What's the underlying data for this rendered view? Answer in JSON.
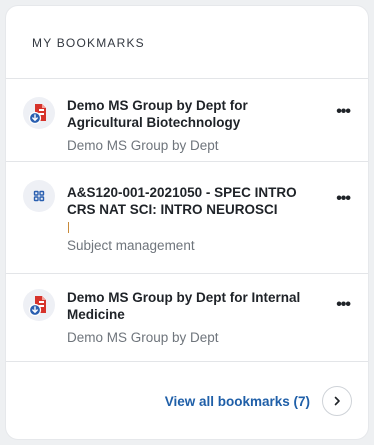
{
  "widget": {
    "title": "MY BOOKMARKS"
  },
  "bookmarks": [
    {
      "title": "Demo MS Group by Dept for Agricultural Biotechnology",
      "subtitle": "Demo MS Group by Dept",
      "icon": "document-download-icon",
      "menu": "•••"
    },
    {
      "title": "A&S120-001-2021050 - SPEC INTRO CRS NAT SCI: INTRO NEUROSCI",
      "subtitle": "Subject management",
      "icon": "grid-icon",
      "menu": "•••"
    },
    {
      "title": "Demo MS Group by Dept for Internal Medicine",
      "subtitle": "Demo MS Group by Dept",
      "icon": "document-download-icon",
      "menu": "•••"
    }
  ],
  "footer": {
    "view_all_label": "View all bookmarks (7)"
  },
  "colors": {
    "accent": "#1f5fa8",
    "doc_icon": "#d6332b",
    "download_icon": "#2a5fb0"
  }
}
